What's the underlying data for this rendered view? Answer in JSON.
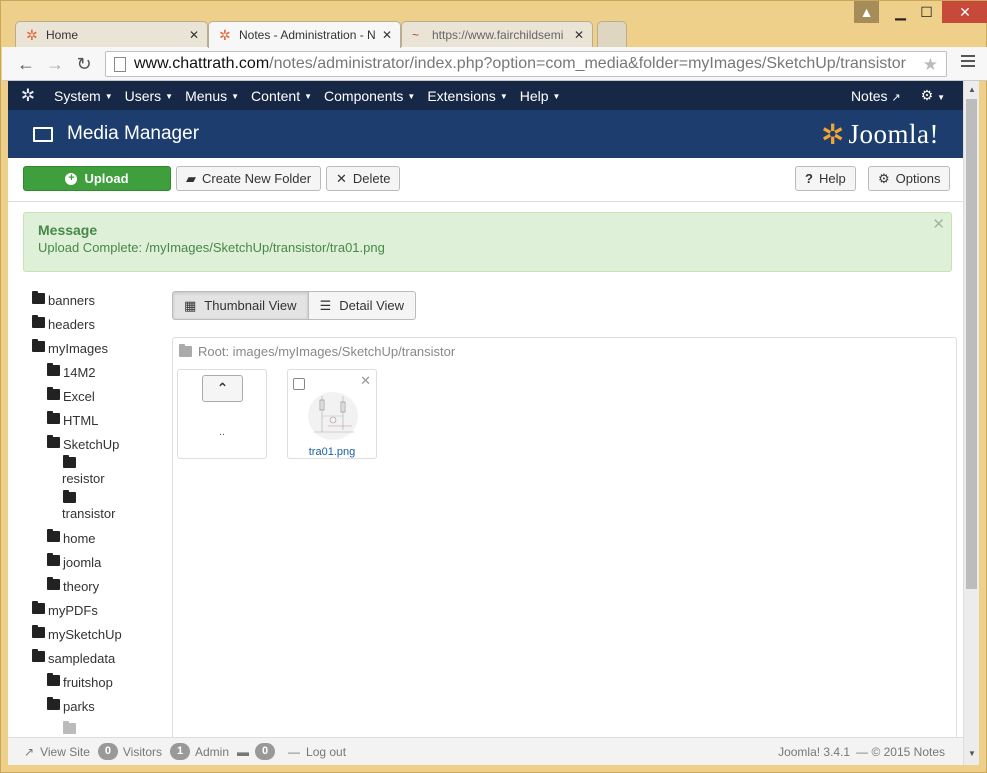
{
  "browser": {
    "tabs": [
      {
        "title": "Home",
        "active": false
      },
      {
        "title": "Notes - Administration - N",
        "active": true
      },
      {
        "title": "https://www.fairchildsemi",
        "active": false
      }
    ],
    "url_host": "www.chattrath.com",
    "url_path": "/notes/administrator/index.php?option=com_media&folder=myImages/SketchUp/transistor"
  },
  "topnav": {
    "menu": [
      "System",
      "Users",
      "Menus",
      "Content",
      "Components",
      "Extensions",
      "Help"
    ],
    "site_link": "Notes"
  },
  "header": {
    "title": "Media Manager",
    "brand": "Joomla!"
  },
  "toolbar": {
    "upload": "Upload",
    "new_folder": "Create New Folder",
    "delete": "Delete",
    "help": "Help",
    "options": "Options"
  },
  "message": {
    "heading": "Message",
    "body": "Upload Complete: /myImages/SketchUp/transistor/tra01.png"
  },
  "tree": [
    {
      "label": "banners",
      "level": 0
    },
    {
      "label": "headers",
      "level": 0
    },
    {
      "label": "myImages",
      "level": 0
    },
    {
      "label": "14M2",
      "level": 1
    },
    {
      "label": "Excel",
      "level": 1
    },
    {
      "label": "HTML",
      "level": 1
    },
    {
      "label": "SketchUp",
      "level": 1
    },
    {
      "label": "resistor",
      "level": 2
    },
    {
      "label": "transistor",
      "level": 2
    },
    {
      "label": "home",
      "level": 1
    },
    {
      "label": "joomla",
      "level": 1
    },
    {
      "label": "theory",
      "level": 1
    },
    {
      "label": "myPDFs",
      "level": 0
    },
    {
      "label": "mySketchUp",
      "level": 0
    },
    {
      "label": "sampledata",
      "level": 0
    },
    {
      "label": "fruitshop",
      "level": 1
    },
    {
      "label": "parks",
      "level": 1
    }
  ],
  "views": {
    "thumbnail": "Thumbnail View",
    "detail": "Detail View"
  },
  "browser_pane": {
    "root_path": "Root: images/myImages/SketchUp/transistor",
    "up_label": "..",
    "file_name": "tra01.png"
  },
  "footer": {
    "view_site": "View Site",
    "visitors_count": "0",
    "visitors_label": "Visitors",
    "admin_count": "1",
    "admin_label": "Admin",
    "messages_count": "0",
    "logout": "Log out",
    "version": "Joomla! 3.4.1",
    "copyright": "— © 2015 Notes"
  }
}
